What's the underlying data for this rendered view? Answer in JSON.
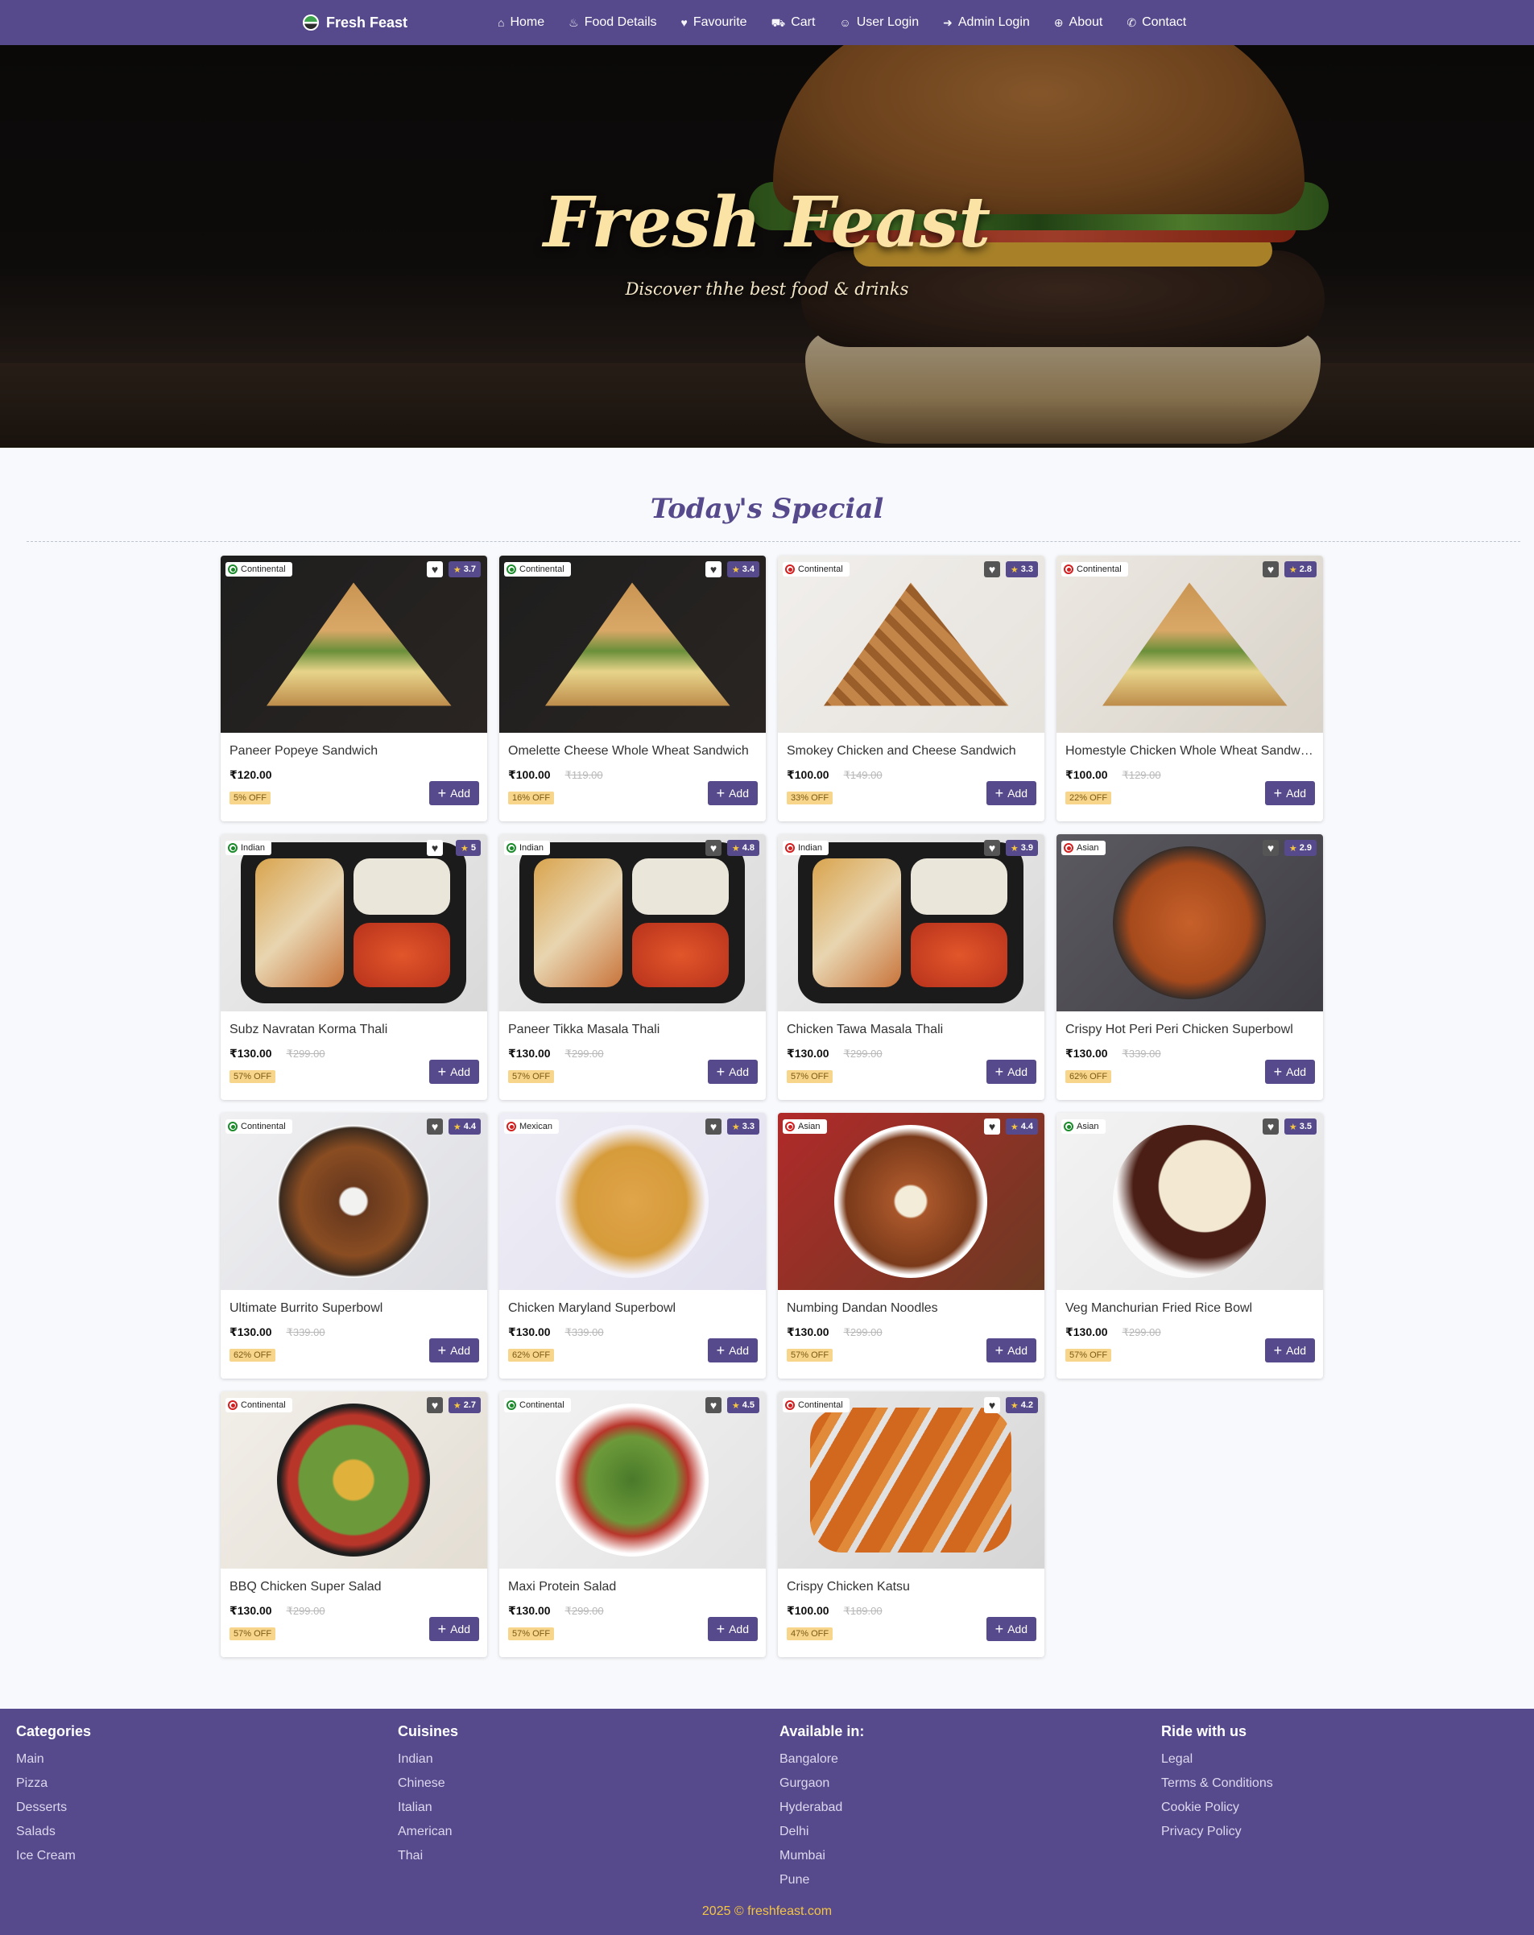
{
  "nav": {
    "brand": "Fresh Feast",
    "links": [
      {
        "label": "Home",
        "icon": "home-icon"
      },
      {
        "label": "Food Details",
        "icon": "pot-icon"
      },
      {
        "label": "Favourite",
        "icon": "heart-icon"
      },
      {
        "label": "Cart",
        "icon": "cart-icon"
      },
      {
        "label": "User Login",
        "icon": "users-icon"
      },
      {
        "label": "Admin Login",
        "icon": "login-icon"
      },
      {
        "label": "About",
        "icon": "globe-icon"
      },
      {
        "label": "Contact",
        "icon": "phone-icon"
      }
    ]
  },
  "hero": {
    "title": "Fresh Feast",
    "subtitle": "Discover thhe best food & drinks"
  },
  "special": {
    "title": "Today's Special",
    "add_label": "Add",
    "items": [
      {
        "name": "Paneer Popeye Sandwich",
        "cuisine": "Continental",
        "veg": true,
        "rating": "3.7",
        "price": "₹120.00",
        "old_price": "",
        "off": "5% OFF",
        "fav_dark": false,
        "food": "sandwich"
      },
      {
        "name": "Omelette Cheese Whole Wheat Sandwich",
        "cuisine": "Continental",
        "veg": true,
        "rating": "3.4",
        "price": "₹100.00",
        "old_price": "₹119.00",
        "off": "16% OFF",
        "fav_dark": false,
        "food": "sandwich"
      },
      {
        "name": "Smokey Chicken and Cheese Sandwich",
        "cuisine": "Continental",
        "veg": false,
        "rating": "3.3",
        "price": "₹100.00",
        "old_price": "₹149.00",
        "off": "33% OFF",
        "fav_dark": true,
        "food": "grill"
      },
      {
        "name": "Homestyle Chicken Whole Wheat Sandwich",
        "cuisine": "Continental",
        "veg": false,
        "rating": "2.8",
        "price": "₹100.00",
        "old_price": "₹129.00",
        "off": "22% OFF",
        "fav_dark": true,
        "food": "sandwich-light"
      },
      {
        "name": "Subz Navratan Korma Thali",
        "cuisine": "Indian",
        "veg": true,
        "rating": "5",
        "price": "₹130.00",
        "old_price": "₹299.00",
        "off": "57% OFF",
        "fav_dark": false,
        "food": "thali"
      },
      {
        "name": "Paneer Tikka Masala Thali",
        "cuisine": "Indian",
        "veg": true,
        "rating": "4.8",
        "price": "₹130.00",
        "old_price": "₹299.00",
        "off": "57% OFF",
        "fav_dark": true,
        "food": "thali"
      },
      {
        "name": "Chicken Tawa Masala Thali",
        "cuisine": "Indian",
        "veg": false,
        "rating": "3.9",
        "price": "₹130.00",
        "old_price": "₹299.00",
        "off": "57% OFF",
        "fav_dark": true,
        "food": "thali"
      },
      {
        "name": "Crispy Hot Peri Peri Chicken Superbowl",
        "cuisine": "Asian",
        "veg": false,
        "rating": "2.9",
        "price": "₹130.00",
        "old_price": "₹339.00",
        "off": "62% OFF",
        "fav_dark": true,
        "food": "bowl-dark"
      },
      {
        "name": "Ultimate Burrito Superbowl",
        "cuisine": "Continental",
        "veg": true,
        "rating": "4.4",
        "price": "₹130.00",
        "old_price": "₹339.00",
        "off": "62% OFF",
        "fav_dark": true,
        "food": "bowl"
      },
      {
        "name": "Chicken Maryland Superbowl",
        "cuisine": "Mexican",
        "veg": false,
        "rating": "3.3",
        "price": "₹130.00",
        "old_price": "₹339.00",
        "off": "62% OFF",
        "fav_dark": true,
        "food": "plate"
      },
      {
        "name": "Numbing Dandan Noodles",
        "cuisine": "Asian",
        "veg": false,
        "rating": "4.4",
        "price": "₹130.00",
        "old_price": "₹299.00",
        "off": "57% OFF",
        "fav_dark": false,
        "food": "noodles"
      },
      {
        "name": "Veg Manchurian Fried Rice Bowl",
        "cuisine": "Asian",
        "veg": true,
        "rating": "3.5",
        "price": "₹130.00",
        "old_price": "₹299.00",
        "off": "57% OFF",
        "fav_dark": true,
        "food": "rice"
      },
      {
        "name": "BBQ Chicken Super Salad",
        "cuisine": "Continental",
        "veg": false,
        "rating": "2.7",
        "price": "₹130.00",
        "old_price": "₹299.00",
        "off": "57% OFF",
        "fav_dark": true,
        "food": "salad-box"
      },
      {
        "name": "Maxi Protein Salad",
        "cuisine": "Continental",
        "veg": true,
        "rating": "4.5",
        "price": "₹130.00",
        "old_price": "₹299.00",
        "off": "57% OFF",
        "fav_dark": true,
        "food": "salad"
      },
      {
        "name": "Crispy Chicken Katsu",
        "cuisine": "Continental",
        "veg": false,
        "rating": "4.2",
        "price": "₹100.00",
        "old_price": "₹189.00",
        "off": "47% OFF",
        "fav_dark": false,
        "food": "katsu"
      }
    ]
  },
  "footer": {
    "columns": [
      {
        "title": "Categories",
        "links": [
          "Main",
          "Pizza",
          "Desserts",
          "Salads",
          "Ice Cream"
        ]
      },
      {
        "title": "Cuisines",
        "links": [
          "Indian",
          "Chinese",
          "Italian",
          "American",
          "Thai"
        ]
      },
      {
        "title": "Available in:",
        "links": [
          "Bangalore",
          "Gurgaon",
          "Hyderabad",
          "Delhi",
          "Mumbai",
          "Pune"
        ]
      },
      {
        "title": "Ride with us",
        "links": [
          "Legal",
          "Terms & Conditions",
          "Cookie Policy",
          "Privacy Policy"
        ]
      }
    ],
    "copyright": "2025 © freshfeast.com"
  },
  "colors": {
    "primary": "#564a8c",
    "accent": "#f5c542",
    "off_badge": "#f7d58b"
  }
}
